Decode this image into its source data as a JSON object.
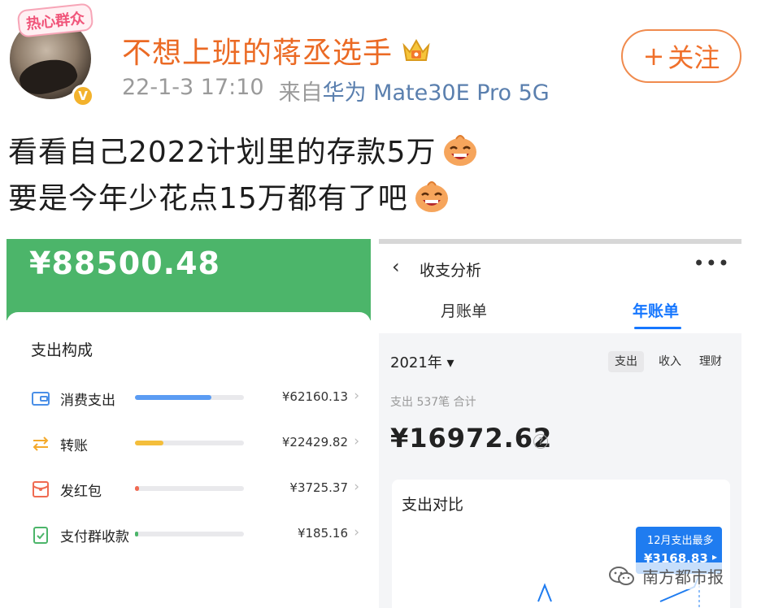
{
  "post": {
    "avatar_badge": "热心群众",
    "username": "不想上班的蒋丞选手",
    "time": "22-1-3 17:10",
    "source_prefix": "来自",
    "device": "华为 Mate30E Pro 5G",
    "follow_plus": "+",
    "follow_label": "关注",
    "line1": "看看自己2022计划里的存款5万",
    "line2": "要是今年少花点15万都有了吧",
    "emoji_icon": "laughing-face-icon",
    "crown_icon": "crown-icon"
  },
  "left_screenshot": {
    "top_amount": "¥88500.48",
    "section_title": "支出构成",
    "categories": [
      {
        "name": "消费支出",
        "amount": "¥62160.13",
        "fill_fraction": 0.7,
        "color": "#5b9cf3",
        "icon": "wallet-icon"
      },
      {
        "name": "转账",
        "amount": "¥22429.82",
        "fill_fraction": 0.26,
        "color": "#f4be3b",
        "icon": "transfer-icon"
      },
      {
        "name": "发红包",
        "amount": "¥3725.37",
        "fill_fraction": 0.04,
        "color": "#f06a52",
        "icon": "red-envelope-icon"
      },
      {
        "name": "支付群收款",
        "amount": "¥185.16",
        "fill_fraction": 0.02,
        "color": "#4cb56a",
        "icon": "group-payment-icon"
      }
    ],
    "chevron": "›"
  },
  "right_screenshot": {
    "back_glyph": "‹",
    "title": "收支分析",
    "more_glyph": "•••",
    "tab_monthly": "月账单",
    "tab_yearly": "年账单",
    "year_select": "2021年 ▾",
    "seg_expense": "支出",
    "seg_income": "收入",
    "seg_finance": "理财",
    "summary_label": "支出 537笔 合计",
    "summary_amount": "¥16972.62",
    "help_glyph": "?",
    "compare_title": "支出对比",
    "tooltip_title": "12月支出最多",
    "tooltip_value": "¥3168.83",
    "tooltip_arrow": "▸"
  },
  "watermark": {
    "text": "南方都市报",
    "icon": "wechat-icon"
  },
  "colors": {
    "username": "#eb6a24",
    "device_link": "#5a7fae",
    "follow_border": "#f08b4e",
    "green_header": "#4cb56a",
    "accent_blue": "#1677ff"
  }
}
